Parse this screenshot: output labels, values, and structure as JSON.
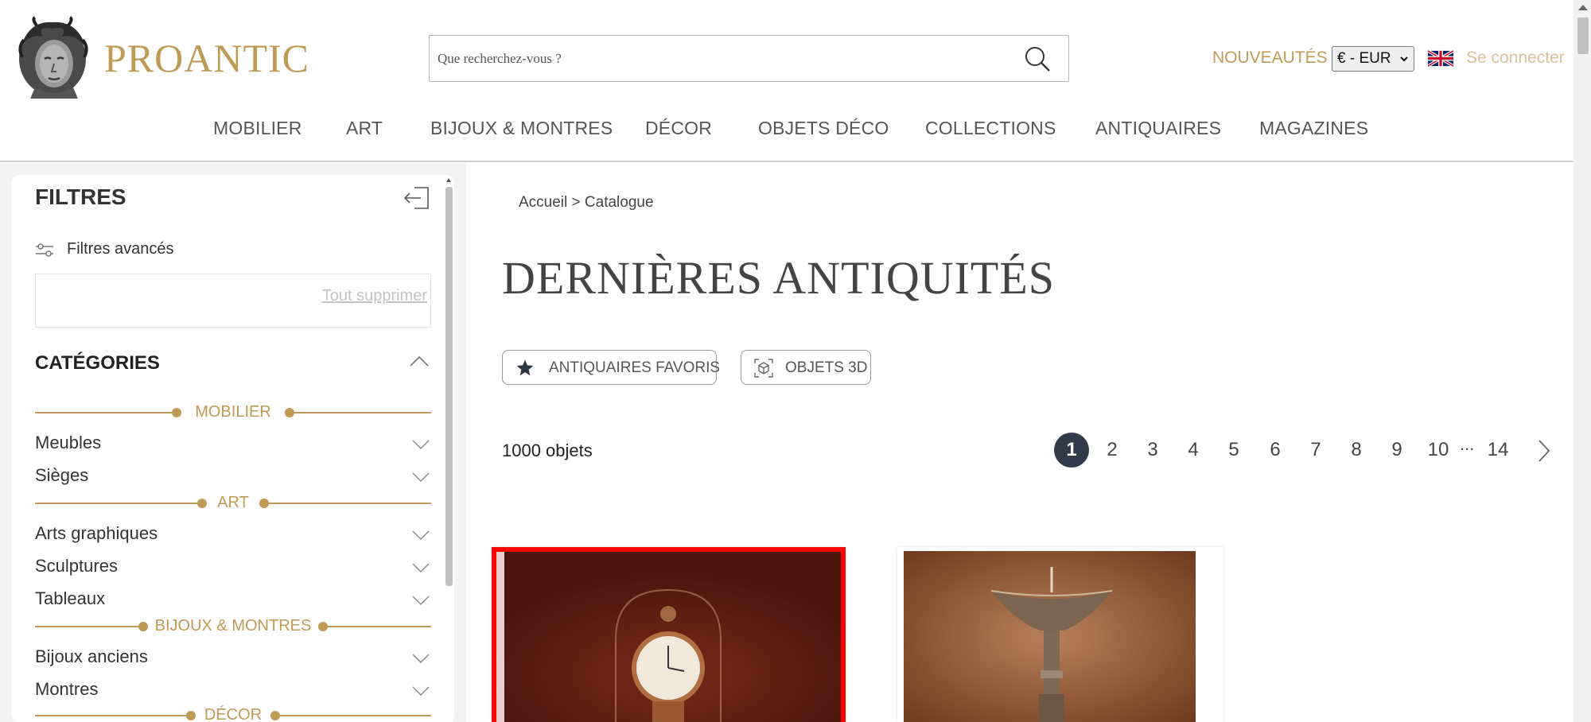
{
  "header": {
    "logo_text": "PROANTIC",
    "search_placeholder": "Que recherchez-vous ?",
    "new_label": "NOUVEAUTÉS",
    "currency": "€ - EUR",
    "login_label": "Se connecter"
  },
  "nav": {
    "items": [
      "MOBILIER",
      "ART",
      "BIJOUX & MONTRES",
      "DÉCOR",
      "OBJETS DÉCO",
      "COLLECTIONS",
      "ANTIQUAIRES",
      "MAGAZINES"
    ]
  },
  "sidebar": {
    "title": "FILTRES",
    "advanced_label": "Filtres avancés",
    "clear_all": "Tout supprimer",
    "categories_title": "CATÉGORIES",
    "groups": [
      {
        "label": "MOBILIER",
        "items": [
          "Meubles",
          "Sièges"
        ]
      },
      {
        "label": "ART",
        "items": [
          "Arts graphiques",
          "Sculptures",
          "Tableaux"
        ]
      },
      {
        "label": "BIJOUX & MONTRES",
        "items": [
          "Bijoux anciens",
          "Montres"
        ]
      },
      {
        "label": "DÉCOR",
        "items": []
      }
    ]
  },
  "main": {
    "breadcrumb": "Accueil > Catalogue",
    "title": "DERNIÈRES ANTIQUITÉS",
    "chips": [
      "ANTIQUAIRES FAVORIS",
      "OBJETS 3D"
    ],
    "count": "1000 objets",
    "pagination": {
      "current": "1",
      "pages": [
        "1",
        "2",
        "3",
        "4",
        "5",
        "6",
        "7",
        "8",
        "9",
        "10"
      ],
      "ellipsis": "...",
      "last": "14"
    }
  },
  "colors": {
    "gold": "#bf9a54",
    "dark_navy": "#303b4a",
    "highlight_red": "#ff0000"
  }
}
